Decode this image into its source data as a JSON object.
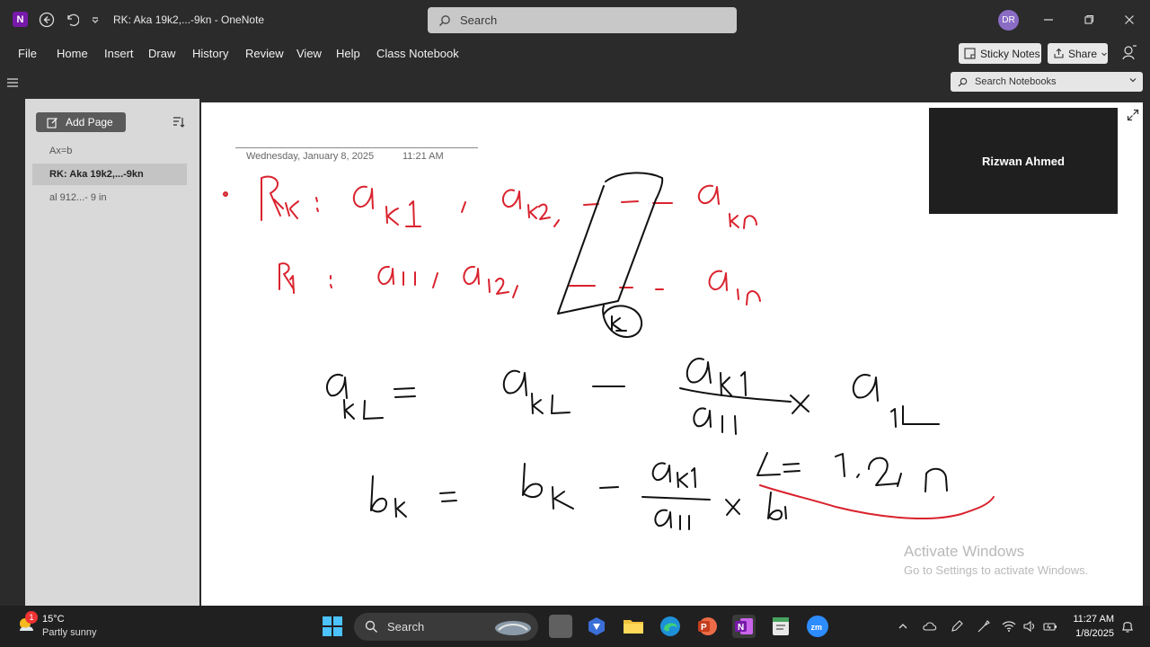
{
  "titlebar": {
    "doc_title": "RK: Aka 19k2,...-9kn  -  OneNote",
    "app_logo": "N",
    "search_placeholder": "Search",
    "avatar_initials": "DR"
  },
  "menu": {
    "items": [
      "File",
      "Home",
      "Insert",
      "Draw",
      "History",
      "Review",
      "View",
      "Help",
      "Class Notebook"
    ],
    "sticky_notes": "Sticky Notes",
    "share": "Share"
  },
  "notebook_search": {
    "placeholder": "Search Notebooks"
  },
  "sidebar": {
    "add_page": "Add Page",
    "pages": [
      {
        "label": "Ax=b",
        "selected": false
      },
      {
        "label": "RK: Aka 19k2,...-9kn",
        "selected": true
      },
      {
        "label": "al 912...- 9 in",
        "selected": false
      }
    ]
  },
  "note": {
    "date": "Wednesday, January 8, 2025",
    "time": "11:21 AM"
  },
  "video": {
    "participant": "Rizwan Ahmed"
  },
  "watermark": {
    "line1": "Activate Windows",
    "line2": "Go to Settings to activate Windows."
  },
  "taskbar": {
    "weather_temp": "15°C",
    "weather_desc": "Partly sunny",
    "weather_badge": "1",
    "search_label": "Search",
    "time": "11:27 AM",
    "date": "1/8/2025",
    "apps": [
      "file-explorer-icon",
      "copilot-icon",
      "edge-icon",
      "powerpoint-icon",
      "onenote-icon",
      "notepad-icon",
      "zoom-icon"
    ]
  },
  "colors": {
    "ink_red": "#d9232e",
    "ink_black": "#111111",
    "onenote_purple": "#7719aa"
  }
}
